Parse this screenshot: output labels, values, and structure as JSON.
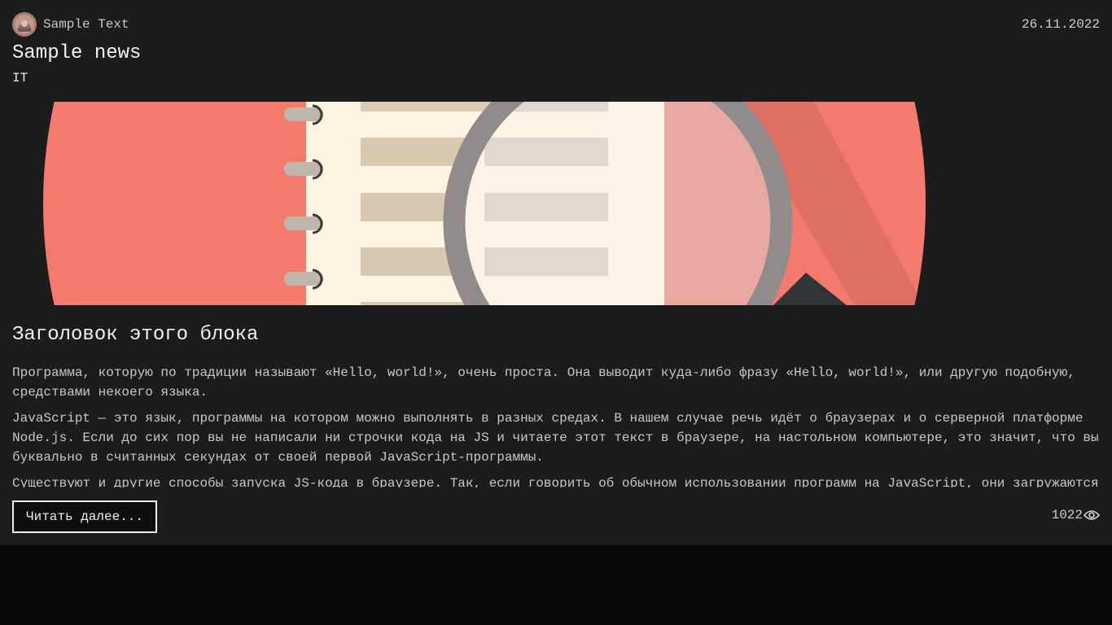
{
  "post": {
    "author_name": "Sample Text",
    "date": "26.11.2022",
    "title": "Sample news",
    "category": "IT"
  },
  "content": {
    "block_title": "Заголовок этого блока",
    "paragraphs": [
      "Программа, которую по традиции называют «Hello, world!», очень проста. Она выводит куда-либо фразу «Hello, world!», или другую подобную, средствами некоего языка.",
      "JavaScript — это язык, программы на котором можно выполнять в разных средах. В нашем случае речь идёт о браузерах и о серверной платформе Node.js. Если до сих пор вы не написали ни строчки кода на JS и читаете этот текст в браузере, на настольном компьютере, это значит, что вы буквально в считанных секундах от своей первой JavaScript-программы.",
      "Существуют и другие способы запуска JS-кода в браузере. Так, если говорить об обычном использовании программ на JavaScript, они загружаются"
    ]
  },
  "footer": {
    "read_more_label": "Читать далее...",
    "views_count": "1022"
  },
  "icons": {
    "avatar": "avatar-image",
    "views": "eye-icon"
  },
  "colors": {
    "card_bg": "#1c1c1c",
    "page_bg": "#080808",
    "hero_red": "#f47a6e",
    "paper": "#fdf3e1"
  }
}
